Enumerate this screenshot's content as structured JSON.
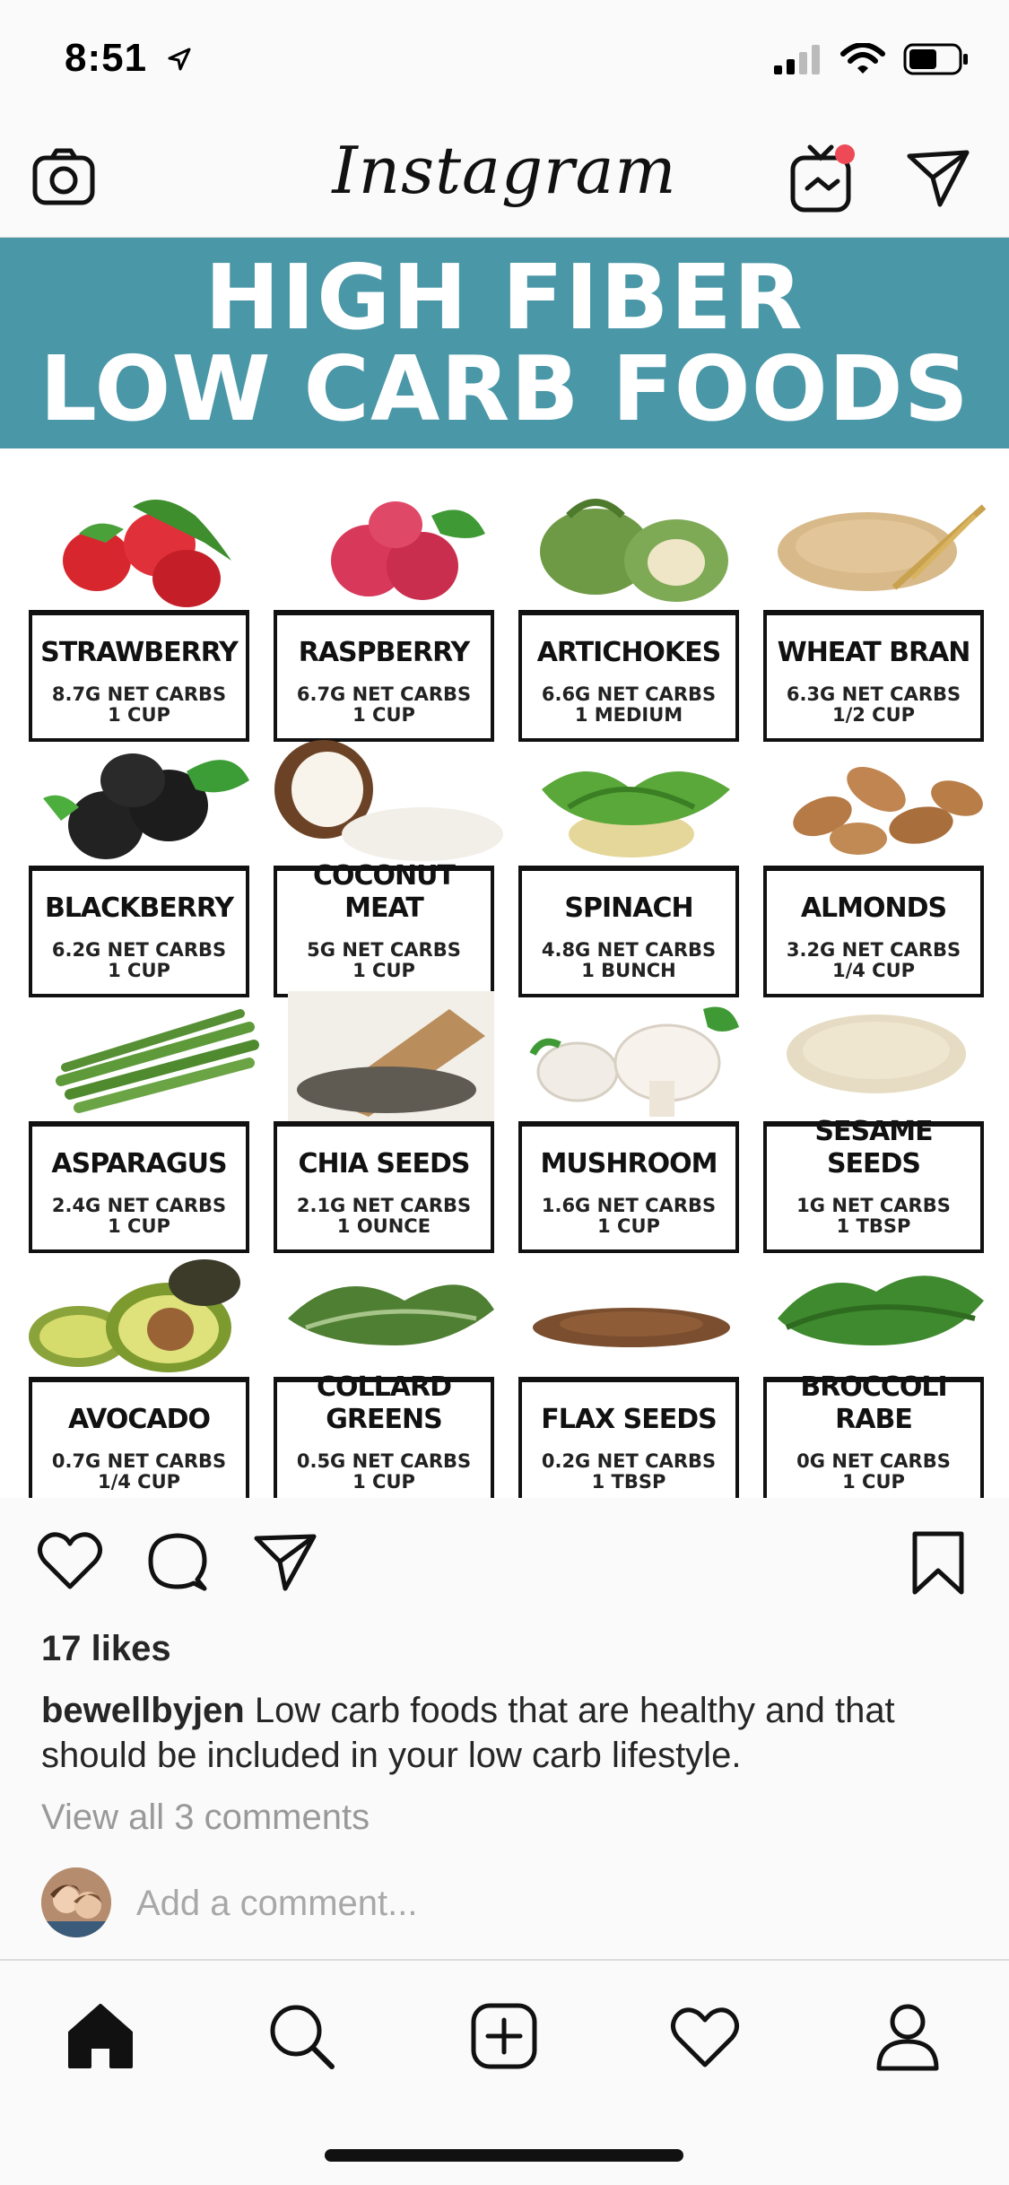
{
  "status": {
    "time": "8:51"
  },
  "header": {
    "app_title": "Instagram"
  },
  "post": {
    "banner": {
      "line1": "HIGH FIBER",
      "line2": "LOW CARB FOODS"
    },
    "foods": [
      {
        "name": "STRAWBERRY",
        "carbs": "8.7G NET CARBS",
        "amount": "1 CUP",
        "picture": "strawberry"
      },
      {
        "name": "RASPBERRY",
        "carbs": "6.7G NET CARBS",
        "amount": "1 CUP",
        "picture": "raspberry"
      },
      {
        "name": "ARTICHOKES",
        "carbs": "6.6G NET CARBS",
        "amount": "1 MEDIUM",
        "picture": "artichoke"
      },
      {
        "name": "WHEAT BRAN",
        "carbs": "6.3G NET CARBS",
        "amount": "1/2 CUP",
        "picture": "wheat-bran"
      },
      {
        "name": "BLACKBERRY",
        "carbs": "6.2G NET CARBS",
        "amount": "1 CUP",
        "picture": "blackberry"
      },
      {
        "name": "COCONUT MEAT",
        "carbs": "5G NET CARBS",
        "amount": "1 CUP",
        "picture": "coconut"
      },
      {
        "name": "SPINACH",
        "carbs": "4.8G NET CARBS",
        "amount": "1 BUNCH",
        "picture": "spinach"
      },
      {
        "name": "ALMONDS",
        "carbs": "3.2G NET CARBS",
        "amount": "1/4 CUP",
        "picture": "almonds"
      },
      {
        "name": "ASPARAGUS",
        "carbs": "2.4G NET CARBS",
        "amount": "1 CUP",
        "picture": "asparagus"
      },
      {
        "name": "CHIA SEEDS",
        "carbs": "2.1G NET CARBS",
        "amount": "1 OUNCE",
        "picture": "chia-seeds"
      },
      {
        "name": "MUSHROOM",
        "carbs": "1.6G NET CARBS",
        "amount": "1 CUP",
        "picture": "mushroom"
      },
      {
        "name": "SESAME SEEDS",
        "carbs": "1G NET CARBS",
        "amount": "1 TBSP",
        "picture": "sesame-seeds"
      },
      {
        "name": "AVOCADO",
        "carbs": "0.7G NET CARBS",
        "amount": "1/4 CUP",
        "picture": "avocado"
      },
      {
        "name": "COLLARD GREENS",
        "carbs": "0.5G NET CARBS",
        "amount": "1 CUP",
        "picture": "collard-greens"
      },
      {
        "name": "FLAX SEEDS",
        "carbs": "0.2G NET CARBS",
        "amount": "1 TBSP",
        "picture": "flax-seeds"
      },
      {
        "name": "BROCCOLI RABE",
        "carbs": "0G NET CARBS",
        "amount": "1 CUP",
        "picture": "broccoli-rabe"
      }
    ],
    "likes": "17 likes",
    "caption": {
      "username": "bewellbyjen",
      "text": " Low carb foods that are healthy and that should be included in your low carb lifestyle."
    },
    "view_comments": "View all 3 comments",
    "comment_placeholder": "Add a comment..."
  },
  "colors": {
    "banner": "#4a97a8",
    "notification_dot": "#ed4956",
    "text": "#262626",
    "muted": "#999999"
  },
  "icons": {
    "header": [
      "camera-icon",
      "igtv-icon",
      "direct-message-icon"
    ],
    "actions": [
      "heart-icon",
      "comment-icon",
      "share-icon",
      "bookmark-icon"
    ],
    "tabs": [
      "home-icon",
      "search-icon",
      "new-post-icon",
      "activity-icon",
      "profile-icon"
    ]
  }
}
